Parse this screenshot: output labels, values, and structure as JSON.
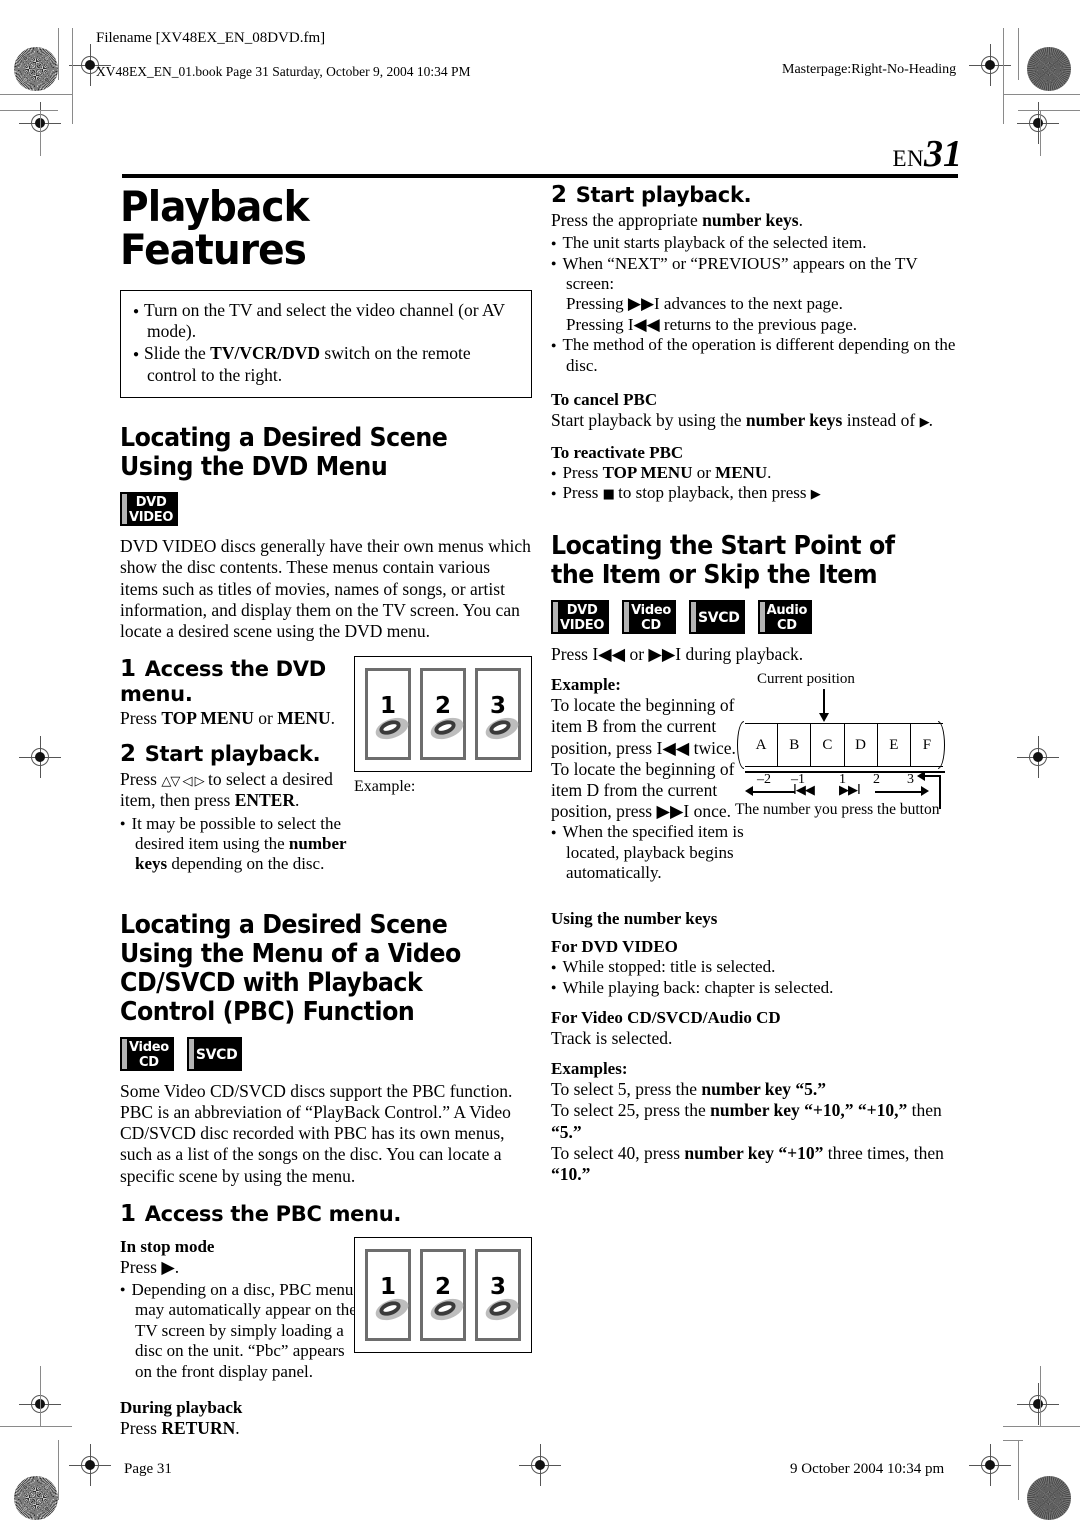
{
  "header": {
    "filename_slug": "Filename [XV48EX_EN_08DVD.fm]",
    "book_slug": "XV48EX_EN_01.book  Page 31  Saturday, October 9, 2004  10:34 PM",
    "masterpage_slug": "Masterpage:Right-No-Heading"
  },
  "folio": {
    "lang": "EN",
    "page_number": "31"
  },
  "footer": {
    "left": "Page 31",
    "right": "9 October 2004 10:34 pm"
  },
  "left_column": {
    "chapter_title": "Playback Features",
    "prep_notes": [
      "Turn on the TV and select the video channel (or AV mode).",
      "Slide the TV/VCR/DVD switch on the remote control to the right."
    ],
    "section1": {
      "heading": "Locating a Desired Scene Using the DVD Menu",
      "badges": [
        {
          "line1": "DVD",
          "line2": "VIDEO"
        }
      ],
      "intro": "DVD VIDEO discs generally have their own menus which show the disc contents. These menus contain various items such as titles of movies, names of songs, or artist information, and display them on the TV screen. You can locate a desired scene using the DVD menu.",
      "step1_number": "1",
      "step1_title": "Access the DVD menu.",
      "step1_body": "Press TOP MENU or MENU.",
      "step2_number": "2",
      "step2_title": "Start playback.",
      "step2_body": "Press △▽ ◁ ▷ to select a desired item, then press ENTER.",
      "step2_bullets": [
        "It may be possible to select the desired item using the number keys depending on the disc."
      ],
      "figure_caption": "Example:",
      "figure_cards": [
        "1",
        "2",
        "3"
      ]
    },
    "section2": {
      "heading": "Locating a Desired Scene Using the Menu of a Video CD/SVCD with Playback Control (PBC) Function",
      "badges": [
        {
          "line1": "Video",
          "line2": "CD"
        },
        {
          "line1": "SVCD",
          "line2": ""
        }
      ],
      "intro": "Some Video CD/SVCD discs support the PBC function. PBC is an abbreviation of “PlayBack Control.” A Video CD/SVCD disc recorded with PBC has its own menus, such as a list of the songs on the disc. You can locate a specific scene by using the menu.",
      "step1_number": "1",
      "step1_title": "Access the PBC menu.",
      "stop_mode_heading": "In stop mode",
      "stop_mode_body": "Press ▶.",
      "stop_mode_bullets": [
        "Depending on a disc, PBC menu may automatically appear on the TV screen by simply loading a disc on the unit. “Pbc” appears on the front display panel."
      ],
      "during_playback_heading": "During playback",
      "during_playback_body": "Press RETURN.",
      "figure_cards": [
        "1",
        "2",
        "3"
      ]
    }
  },
  "right_column": {
    "step2_number": "2",
    "step2_title": "Start playback.",
    "step2_body": "Press the appropriate number keys.",
    "step2_bullets": [
      "The unit starts playback of the selected item.",
      "When “NEXT” or “PREVIOUS” appears on the TV screen:",
      "The method of the operation is different depending on the disc."
    ],
    "step2_sub_lines": [
      "Pressing ▶▶I advances to the next page.",
      "Pressing I◀◀ returns to the previous page."
    ],
    "cancel_pbc_heading": "To cancel PBC",
    "cancel_pbc_body": "Start playback by using the number keys instead of ▶.",
    "reactivate_pbc_heading": "To reactivate PBC",
    "reactivate_pbc_bullets": [
      "Press TOP MENU or MENU.",
      "Press ■ to stop playback, then press ▶"
    ],
    "section3": {
      "heading": "Locating the Start Point of the Item or Skip the Item",
      "badges": [
        {
          "line1": "DVD",
          "line2": "VIDEO"
        },
        {
          "line1": "Video",
          "line2": "CD"
        },
        {
          "line1": "SVCD",
          "line2": ""
        },
        {
          "line1": "Audio",
          "line2": "CD"
        }
      ],
      "press_line": "Press I◀◀ or ▶▶I during playback.",
      "example_heading": "Example:",
      "example_lines": [
        "To locate the beginning of item B from the current position, press I◀◀ twice.",
        "To locate the beginning of item D from the current position, press ▶▶I once."
      ],
      "example_bullets": [
        "When the specified item is located, playback begins automatically."
      ]
    },
    "diagram": {
      "current_position_label": "Current position",
      "items": [
        "A",
        "B",
        "C",
        "D",
        "E",
        "F"
      ],
      "ticks": [
        "–2",
        "–1",
        "1",
        "2",
        "3"
      ],
      "left_arrow_glyph": "I◀◀",
      "right_arrow_glyph": "▶▶I",
      "bottom_label": "The number you press the button"
    },
    "number_keys": {
      "heading_bold": "Using the ",
      "heading_strong": "number keys",
      "dvd_heading": "For DVD VIDEO",
      "dvd_bullets": [
        "While stopped: title is selected.",
        "While playing back: chapter is selected."
      ],
      "cd_heading": "For Video CD/SVCD/Audio CD",
      "cd_body": "Track is selected.",
      "examples_heading": "Examples:",
      "examples": [
        "To select 5, press the number key “5.”",
        "To select 25, press the number key “+10,” “+10,” then “5.”",
        "To select 40, press number key “+10” three times, then “10.”"
      ]
    }
  }
}
